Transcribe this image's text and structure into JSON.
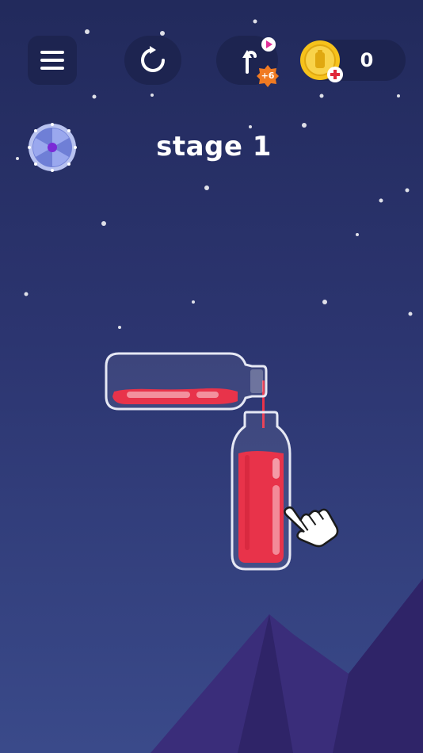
{
  "header": {
    "menu": {
      "icon": "hamburger-menu-icon"
    },
    "restart": {
      "icon": "restart-icon"
    },
    "undo": {
      "icon": "undo-icon",
      "badge": "+6",
      "video_icon": "video-play-icon"
    },
    "coins": {
      "icon": "coin-icon",
      "count": "0",
      "add_icon": "plus-icon"
    }
  },
  "skin_wheel": {
    "icon": "skin-wheel-icon"
  },
  "stage": {
    "title": "stage 1"
  },
  "bottles": {
    "source": {
      "liquid_color": "#e8334a",
      "state": "tilted-pouring"
    },
    "target": {
      "liquid_color": "#e8334a",
      "state": "filled"
    }
  },
  "tutorial": {
    "icon": "tap-hand-icon"
  },
  "colors": {
    "background_top": "#222a5c",
    "background_bottom": "#3a4a8a",
    "button_bg": "#1d2450",
    "liquid": "#e8334a",
    "coin": "#f6c21b",
    "badge": "#f07a22",
    "mountain": "#3a2d7a"
  }
}
